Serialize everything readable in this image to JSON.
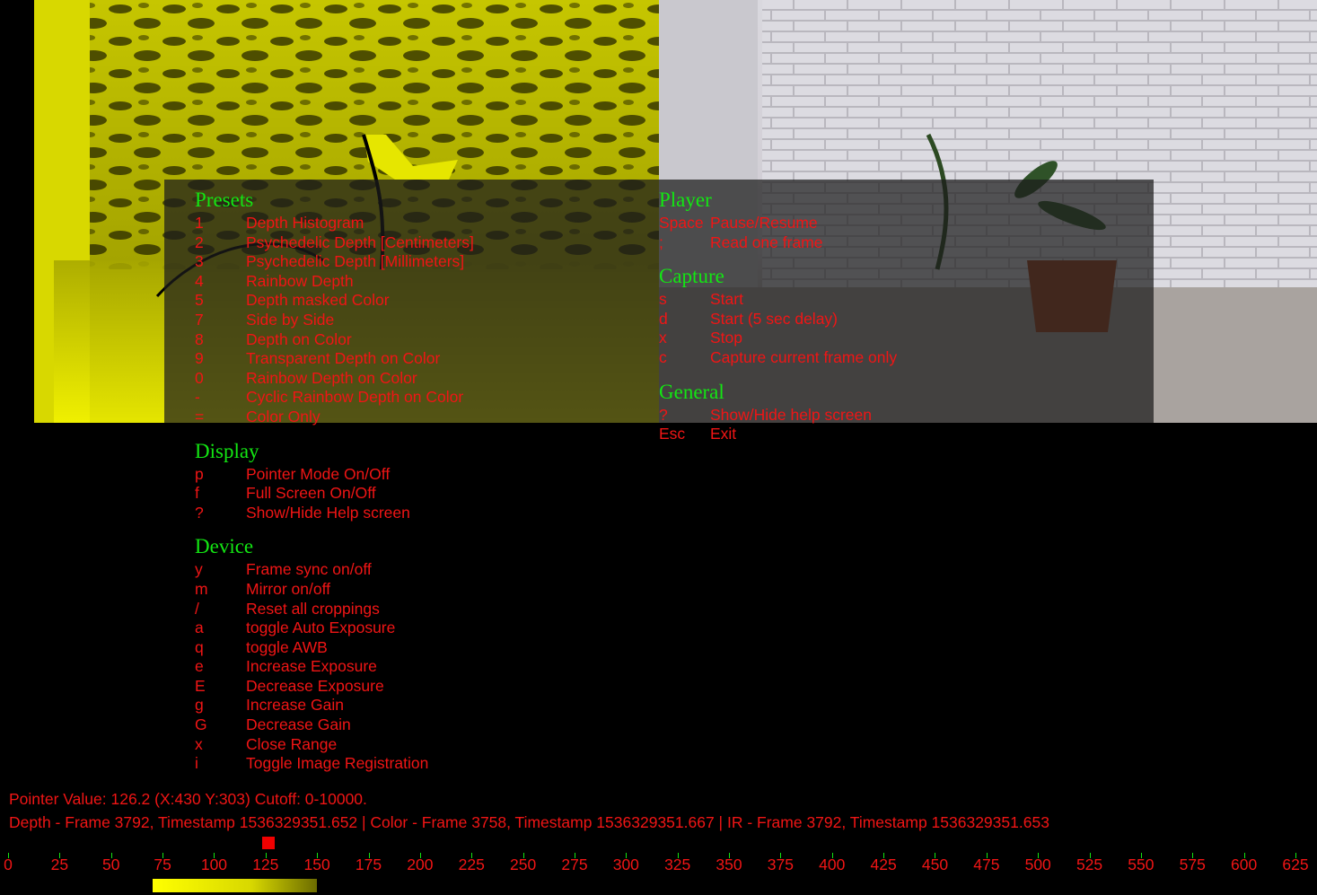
{
  "colors": {
    "heading": "#13e613",
    "text": "#f01515",
    "overlay": "rgba(28,28,28,0.72)",
    "depth": "#e8e800"
  },
  "help": {
    "left_sections": [
      {
        "title": "Presets",
        "items": [
          {
            "key": "1",
            "label": "Depth Histogram"
          },
          {
            "key": "2",
            "label": "Psychedelic Depth [Centimeters]"
          },
          {
            "key": "3",
            "label": "Psychedelic Depth [Millimeters]"
          },
          {
            "key": "4",
            "label": "Rainbow Depth"
          },
          {
            "key": "5",
            "label": "Depth masked Color"
          },
          {
            "key": "7",
            "label": "Side by Side"
          },
          {
            "key": "8",
            "label": "Depth on Color"
          },
          {
            "key": "9",
            "label": "Transparent Depth on Color"
          },
          {
            "key": "0",
            "label": "Rainbow Depth on Color"
          },
          {
            "key": "-",
            "label": "Cyclic Rainbow Depth on Color"
          },
          {
            "key": "=",
            "label": "Color Only"
          }
        ]
      },
      {
        "title": "Display",
        "items": [
          {
            "key": "p",
            "label": "Pointer Mode On/Off"
          },
          {
            "key": "f",
            "label": "Full Screen On/Off"
          },
          {
            "key": "?",
            "label": "Show/Hide Help screen"
          }
        ]
      },
      {
        "title": "Device",
        "items": [
          {
            "key": "y",
            "label": "Frame sync on/off"
          },
          {
            "key": "m",
            "label": "Mirror on/off"
          },
          {
            "key": "/",
            "label": "Reset all croppings"
          },
          {
            "key": "a",
            "label": "toggle Auto Exposure"
          },
          {
            "key": "q",
            "label": "toggle AWB"
          },
          {
            "key": "e",
            "label": "Increase Exposure"
          },
          {
            "key": "E",
            "label": "Decrease Exposure"
          },
          {
            "key": "g",
            "label": "Increase Gain"
          },
          {
            "key": "G",
            "label": "Decrease Gain"
          },
          {
            "key": "x",
            "label": "Close Range"
          },
          {
            "key": "i",
            "label": "Toggle Image Registration"
          }
        ]
      }
    ],
    "right_sections": [
      {
        "title": "Player",
        "items": [
          {
            "key": "Space",
            "label": "Pause/Resume"
          },
          {
            "key": ";",
            "label": "Read one frame"
          }
        ]
      },
      {
        "title": "Capture",
        "items": [
          {
            "key": "s",
            "label": "Start"
          },
          {
            "key": "d",
            "label": "Start (5 sec delay)"
          },
          {
            "key": "x",
            "label": "Stop"
          },
          {
            "key": "c",
            "label": "Capture current frame only"
          }
        ]
      },
      {
        "title": "General",
        "items": [
          {
            "key": "?",
            "label": "Show/Hide help screen"
          },
          {
            "key": "Esc",
            "label": "Exit"
          }
        ]
      }
    ]
  },
  "status": {
    "pointer": "Pointer Value: 126.2 (X:430 Y:303) Cutoff: 0-10000.",
    "frames": "Depth - Frame 3792, Timestamp 1536329351.652 | Color - Frame 3758, Timestamp 1536329351.667 | IR - Frame 3792, Timestamp 1536329351.653"
  },
  "ruler": {
    "ticks": [
      "0",
      "25",
      "50",
      "75",
      "100",
      "125",
      "150",
      "175",
      "200",
      "225",
      "250",
      "275",
      "300",
      "325",
      "350",
      "375",
      "400",
      "425",
      "450",
      "475",
      "500",
      "525",
      "550",
      "575",
      "600",
      "625"
    ],
    "pointer_value": 126.2,
    "range_start": 70,
    "range_end": 150
  }
}
